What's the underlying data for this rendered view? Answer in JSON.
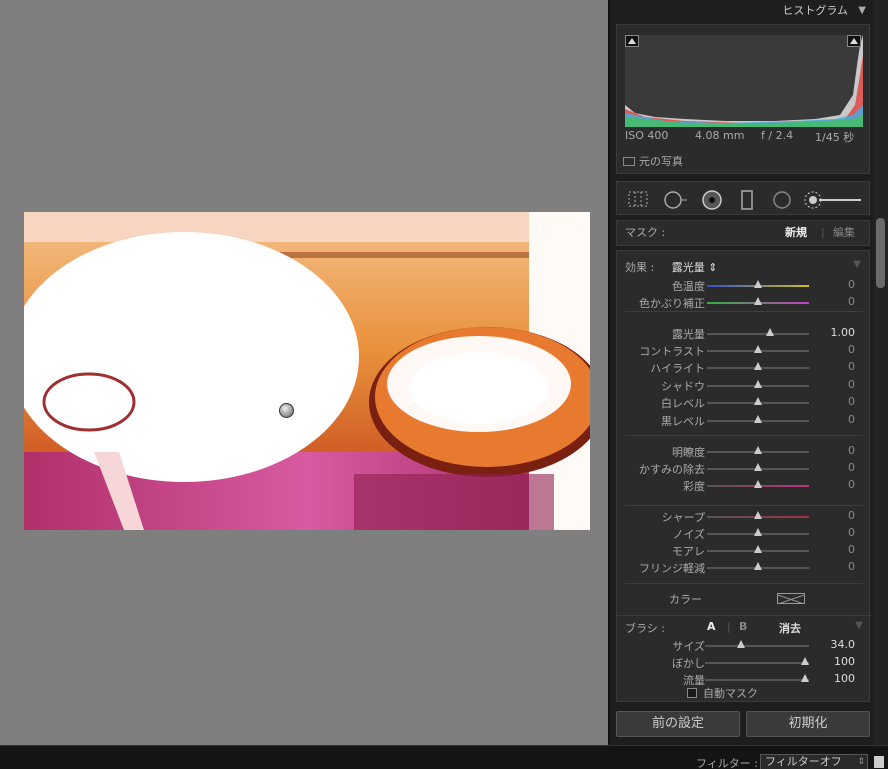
{
  "histogram": {
    "title": "ヒストグラム",
    "iso": "ISO 400",
    "focal": "4.08 mm",
    "aperture": "f / 2.4",
    "shutter": "1/45 秒",
    "original_photo": "元の写真"
  },
  "mask": {
    "label": "マスク :",
    "new": "新規",
    "edit": "編集"
  },
  "effect": {
    "label": "効果 :",
    "value": "露光量 ⇕"
  },
  "sliders": [
    {
      "name": "色温度",
      "value": "0",
      "pos": 0.5
    },
    {
      "name": "色かぶり補正",
      "value": "0",
      "pos": 0.5
    },
    {
      "name": "露光量",
      "value": "1.00",
      "pos": 0.62
    },
    {
      "name": "コントラスト",
      "value": "0",
      "pos": 0.5
    },
    {
      "name": "ハイライト",
      "value": "0",
      "pos": 0.5
    },
    {
      "name": "シャドウ",
      "value": "0",
      "pos": 0.5
    },
    {
      "name": "白レベル",
      "value": "0",
      "pos": 0.5
    },
    {
      "name": "黒レベル",
      "value": "0",
      "pos": 0.5
    },
    {
      "name": "明瞭度",
      "value": "0",
      "pos": 0.5
    },
    {
      "name": "かすみの除去",
      "value": "0",
      "pos": 0.5
    },
    {
      "name": "彩度",
      "value": "0",
      "pos": 0.5
    },
    {
      "name": "シャープ",
      "value": "0",
      "pos": 0.5
    },
    {
      "name": "ノイズ",
      "value": "0",
      "pos": 0.5
    },
    {
      "name": "モアレ",
      "value": "0",
      "pos": 0.5
    },
    {
      "name": "フリンジ軽減",
      "value": "0",
      "pos": 0.5
    }
  ],
  "color": {
    "label": "カラー"
  },
  "brush": {
    "label": "ブラシ :",
    "a": "A",
    "b": "B",
    "erase": "消去",
    "sliders": [
      {
        "name": "サイズ",
        "value": "34.0",
        "pos": 0.36
      },
      {
        "name": "ぼかし",
        "value": "100",
        "pos": 1.0
      },
      {
        "name": "流量",
        "value": "100",
        "pos": 1.0
      }
    ],
    "auto_mask": "自動マスク"
  },
  "buttons": {
    "previous": "前の設定",
    "reset": "初期化"
  },
  "filmstrip": {
    "filter_label": "フィルター :",
    "filter_value": "フィルターオフ"
  }
}
